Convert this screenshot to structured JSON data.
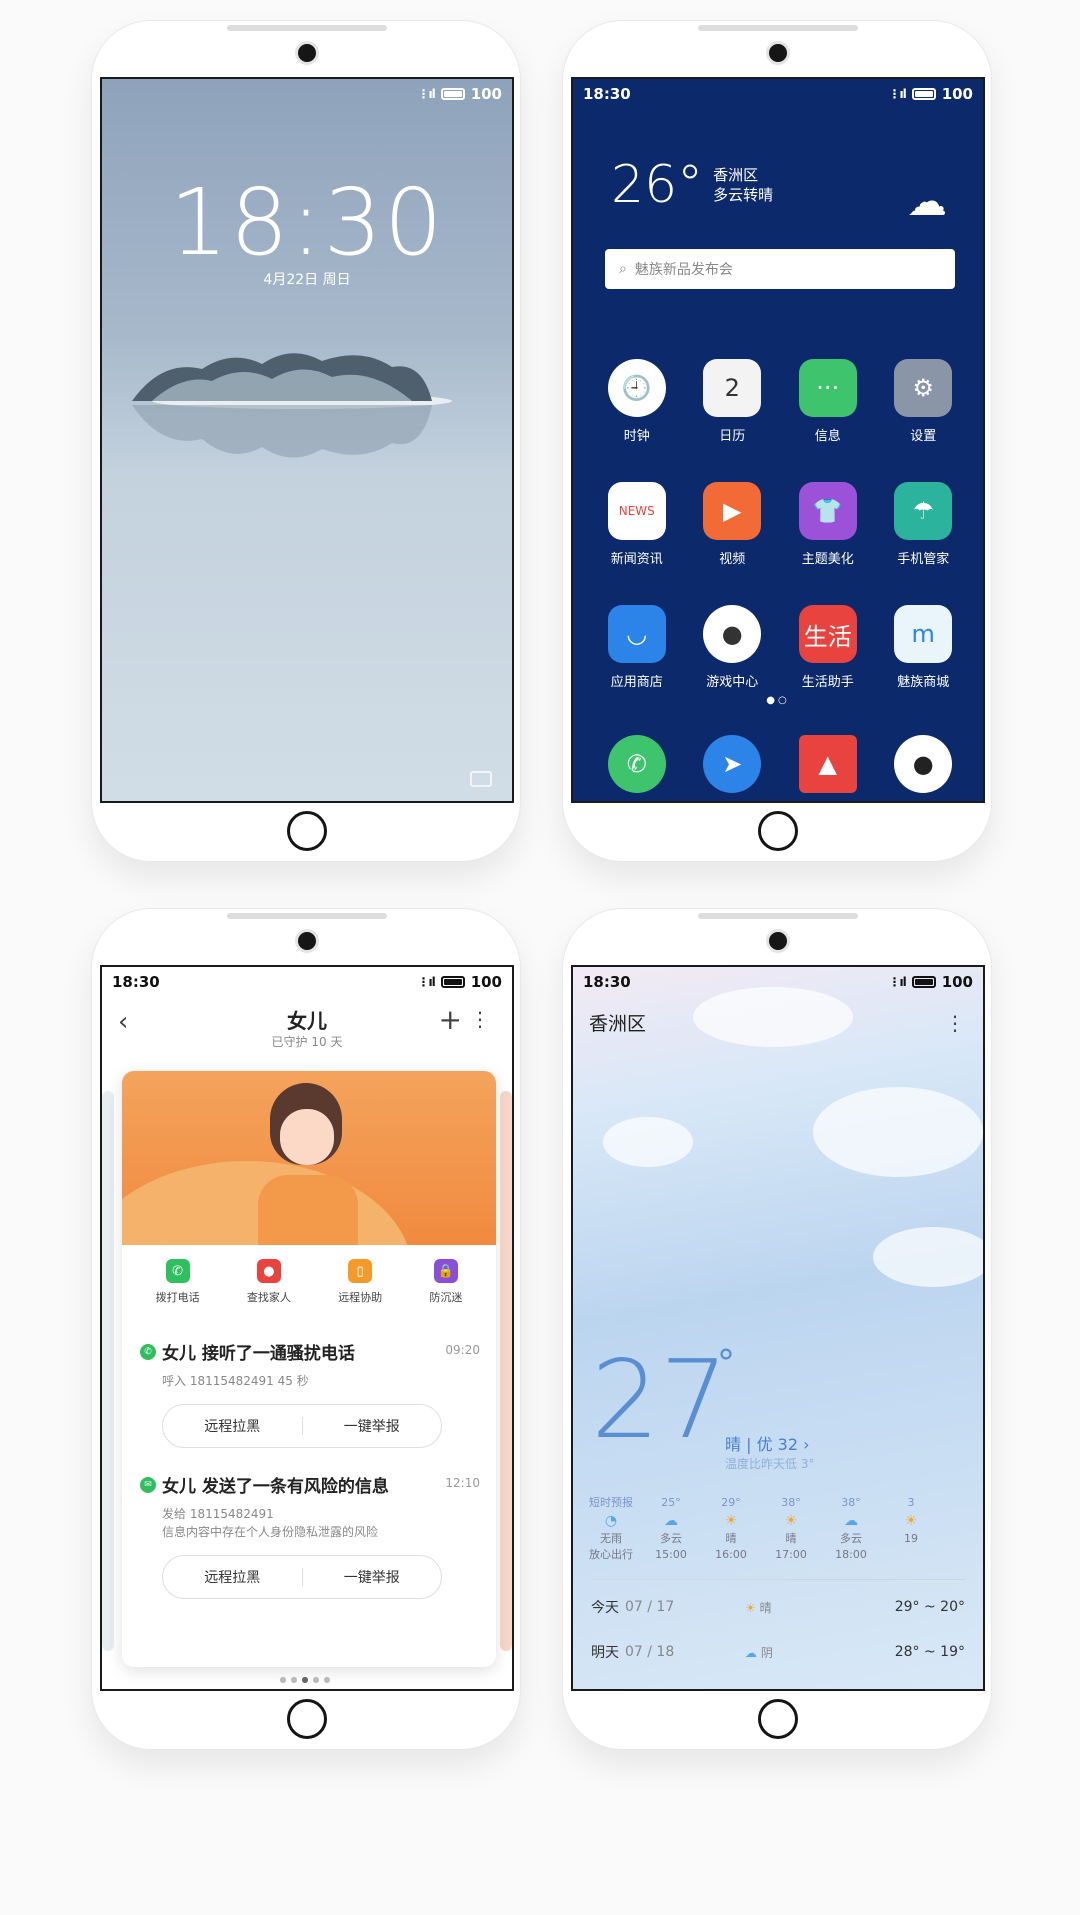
{
  "status": {
    "time": "18:30",
    "signal": "⋮ıl",
    "battery": "100"
  },
  "lock": {
    "time": "18:30",
    "date": "4月22日 周日"
  },
  "home": {
    "weather": {
      "temp": "26°",
      "district": "香洲区",
      "condition": "多云转晴"
    },
    "search_placeholder": "魅族新品发布会",
    "apps": [
      {
        "label": "时钟",
        "icon": "clock-icon",
        "glyph": "🕘",
        "color": "#ffffff"
      },
      {
        "label": "日历",
        "icon": "calendar-icon",
        "glyph": "2",
        "color": "#f3f3f3"
      },
      {
        "label": "信息",
        "icon": "message-icon",
        "glyph": "···",
        "color": "#3ec46d"
      },
      {
        "label": "设置",
        "icon": "gear-icon",
        "glyph": "⚙",
        "color": "#8a96a8"
      },
      {
        "label": "新闻资讯",
        "icon": "news-icon",
        "glyph": "NEWS",
        "color": "#ffffff"
      },
      {
        "label": "视频",
        "icon": "video-icon",
        "glyph": "▶",
        "color": "#f26a35"
      },
      {
        "label": "主题美化",
        "icon": "theme-icon",
        "glyph": "👕",
        "color": "#9b52d8"
      },
      {
        "label": "手机管家",
        "icon": "umbrella-icon",
        "glyph": "☂",
        "color": "#2bb39e"
      },
      {
        "label": "应用商店",
        "icon": "appstore-icon",
        "glyph": "◡",
        "color": "#2d84e8"
      },
      {
        "label": "游戏中心",
        "icon": "gamecenter-icon",
        "glyph": "●",
        "color": "#ffffff"
      },
      {
        "label": "生活助手",
        "icon": "life-icon",
        "glyph": "生活",
        "color": "#e8433e"
      },
      {
        "label": "魅族商城",
        "icon": "store-icon",
        "glyph": "m",
        "color": "#e9f5fb"
      }
    ],
    "dock": [
      {
        "icon": "phone-icon",
        "glyph": "✆",
        "color": "#3ec46d"
      },
      {
        "icon": "browser-icon",
        "glyph": "➤",
        "color": "#2d84e8"
      },
      {
        "icon": "gallery-icon",
        "glyph": "▲",
        "color": "#e8433e"
      },
      {
        "icon": "camera-icon",
        "glyph": "●",
        "color": "#ffffff"
      }
    ]
  },
  "family": {
    "title": "女儿",
    "subtitle": "已守护 10 天",
    "actions": [
      "拨打电话",
      "查找家人",
      "远程协助",
      "防沉迷"
    ],
    "events": [
      {
        "title": "女儿 接听了一通骚扰电话",
        "time": "09:20",
        "line1": "呼入 18115482491 45 秒",
        "line2": "",
        "btn1": "远程拉黑",
        "btn2": "一键举报"
      },
      {
        "title": "女儿 发送了一条有风险的信息",
        "time": "12:10",
        "line1": "发给 18115482491",
        "line2": "信息内容中存在个人身份隐私泄露的风险",
        "btn1": "远程拉黑",
        "btn2": "一键举报"
      }
    ]
  },
  "weather": {
    "district": "香洲区",
    "temp": "27",
    "degree": "°",
    "condition": "晴 | 优 32 ›",
    "feels": "温度比昨天低 3°",
    "hourly": [
      {
        "t": "短时预报",
        "icon": "◔",
        "c": "无雨",
        "h": "放心出行"
      },
      {
        "t": "25°",
        "icon": "☁",
        "c": "多云",
        "h": "15:00"
      },
      {
        "t": "29°",
        "icon": "☀",
        "c": "晴",
        "h": "16:00"
      },
      {
        "t": "38°",
        "icon": "☀",
        "c": "晴",
        "h": "17:00"
      },
      {
        "t": "38°",
        "icon": "☁",
        "c": "多云",
        "h": "18:00"
      },
      {
        "t": "3",
        "icon": "☀",
        "c": "",
        "h": "19"
      }
    ],
    "days": [
      {
        "d": "今天",
        "date": "07 / 17",
        "cond": "晴",
        "icon": "☀",
        "hi": "29°",
        "lo": "20°"
      },
      {
        "d": "明天",
        "date": "07 / 18",
        "cond": "阴",
        "icon": "☁",
        "hi": "28°",
        "lo": "19°"
      }
    ]
  }
}
